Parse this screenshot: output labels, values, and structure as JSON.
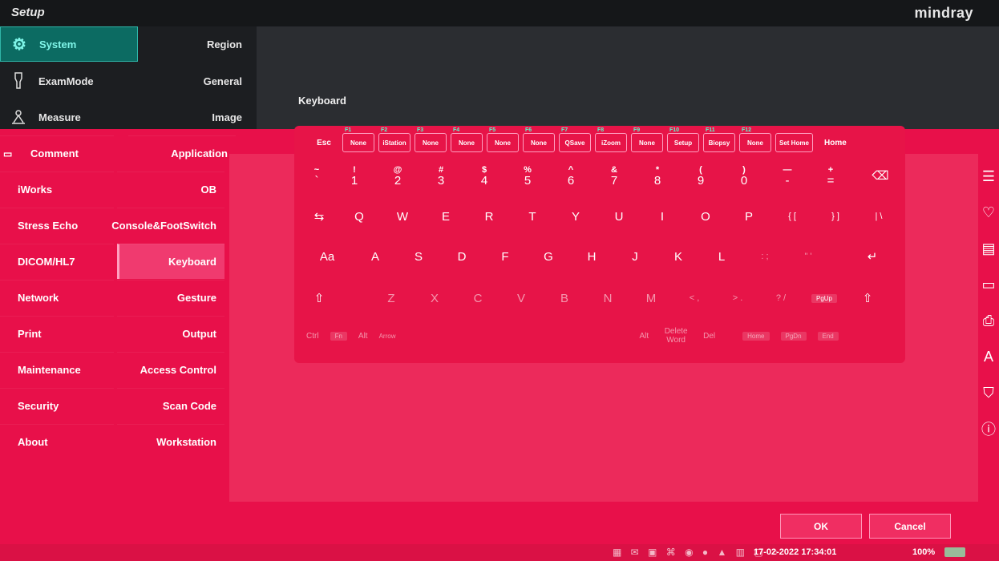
{
  "app": {
    "title": "Setup",
    "brand": "mindray"
  },
  "categories": [
    {
      "label": "System",
      "icon": "gear-icon",
      "selected": true
    },
    {
      "label": "ExamMode",
      "icon": "probe-icon"
    },
    {
      "label": "Measure",
      "icon": "measure-icon"
    },
    {
      "label": "Comment",
      "icon": "comment-icon"
    },
    {
      "label": "iWorks"
    },
    {
      "label": "Stress Echo"
    },
    {
      "label": "DICOM/HL7"
    },
    {
      "label": "Network"
    },
    {
      "label": "Print"
    },
    {
      "label": "Maintenance"
    },
    {
      "label": "Security"
    },
    {
      "label": "About"
    }
  ],
  "subitems": [
    {
      "label": "Region"
    },
    {
      "label": "General"
    },
    {
      "label": "Image"
    },
    {
      "label": "Application"
    },
    {
      "label": "OB"
    },
    {
      "label": "Console&FootSwitch"
    },
    {
      "label": "Keyboard",
      "selected": true
    },
    {
      "label": "Gesture"
    },
    {
      "label": "Output"
    },
    {
      "label": "Access Control"
    },
    {
      "label": "Scan Code"
    },
    {
      "label": "Workstation"
    }
  ],
  "keyboard": {
    "heading": "Keyboard",
    "function_row": [
      {
        "label": "Esc",
        "tag": ""
      },
      {
        "label": "None",
        "tag": "F1"
      },
      {
        "label": "iStation",
        "tag": "F2"
      },
      {
        "label": "None",
        "tag": "F3"
      },
      {
        "label": "None",
        "tag": "F4"
      },
      {
        "label": "None",
        "tag": "F5"
      },
      {
        "label": "None",
        "tag": "F6"
      },
      {
        "label": "QSave",
        "tag": "F7"
      },
      {
        "label": "iZoom",
        "tag": "F8"
      },
      {
        "label": "None",
        "tag": "F9"
      },
      {
        "label": "Setup",
        "tag": "F10"
      },
      {
        "label": "Biopsy",
        "tag": "F11"
      },
      {
        "label": "None",
        "tag": "F12"
      },
      {
        "label": "Set Home",
        "tag": ""
      },
      {
        "label": "Home",
        "tag": ""
      }
    ],
    "number_row": [
      {
        "up": "~",
        "dn": "`"
      },
      {
        "up": "!",
        "dn": "1"
      },
      {
        "up": "@",
        "dn": "2"
      },
      {
        "up": "#",
        "dn": "3"
      },
      {
        "up": "$",
        "dn": "4"
      },
      {
        "up": "%",
        "dn": "5"
      },
      {
        "up": "^",
        "dn": "6"
      },
      {
        "up": "&",
        "dn": "7"
      },
      {
        "up": "*",
        "dn": "8"
      },
      {
        "up": "(",
        "dn": "9"
      },
      {
        "up": ")",
        "dn": "0"
      },
      {
        "up": "—",
        "dn": "-"
      },
      {
        "up": "+",
        "dn": "="
      },
      {
        "up": "",
        "dn": "⌫"
      }
    ],
    "qwerty_row": [
      "⇆",
      "Q",
      "W",
      "E",
      "R",
      "T",
      "Y",
      "U",
      "I",
      "O",
      "P",
      "{ [",
      "} ]",
      "| \\"
    ],
    "home_row": [
      "Aa",
      "A",
      "S",
      "D",
      "F",
      "G",
      "H",
      "J",
      "K",
      "L",
      ": ;",
      "\" '",
      "",
      "↵"
    ],
    "shift_row": [
      "⇧",
      "",
      "Z",
      "X",
      "C",
      "V",
      "B",
      "N",
      "M",
      "< ,",
      "> .",
      "? /",
      "PgUp",
      "⇧"
    ],
    "bottom_row": [
      "Ctrl",
      "Fn",
      "Alt",
      "Arrow",
      "Alt",
      "Delete Word",
      "Del",
      "Home",
      "PgDn",
      "End"
    ]
  },
  "right_icons": [
    "keyboard-layout-icon",
    "heart-icon",
    "document-icon",
    "monitor-icon",
    "printer-icon",
    "text-icon",
    "shield-icon",
    "info-icon"
  ],
  "buttons": {
    "ok": "OK",
    "cancel": "Cancel"
  },
  "status": {
    "datetime": "17-02-2022 17:34:01",
    "zoom": "100%"
  }
}
